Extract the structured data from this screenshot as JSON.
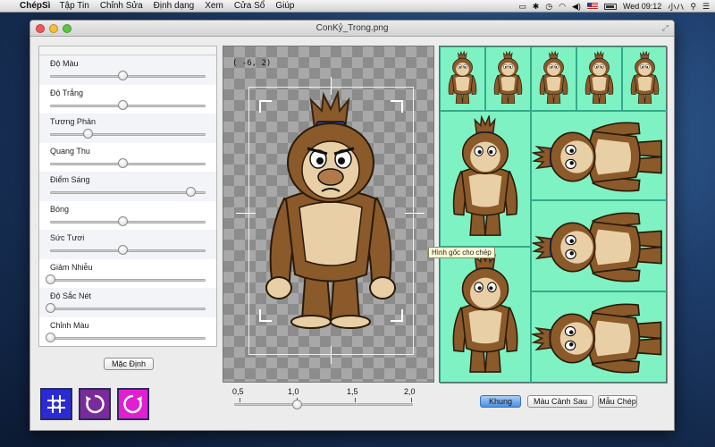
{
  "menubar": {
    "app_name": "ChépSì",
    "items": [
      "Tập Tin",
      "Chỉnh Sửa",
      "Định dạng",
      "Xem",
      "Cửa Sổ",
      "Giúp"
    ],
    "clock": "Wed 09:12",
    "user": "小ハ"
  },
  "window": {
    "title": "ConKỷ_Trong.png"
  },
  "adjustments": [
    {
      "label": "Độ Màu",
      "value": 0.5
    },
    {
      "label": "Độ Trắng",
      "value": 0.5
    },
    {
      "label": "Tương Phản",
      "value": 0.26
    },
    {
      "label": "Quang Thu",
      "value": 0.5
    },
    {
      "label": "Điểm Sáng",
      "value": 0.97
    },
    {
      "label": "Bóng",
      "value": 0.5
    },
    {
      "label": "Sức Tươi",
      "value": 0.5
    },
    {
      "label": "Giảm Nhiễu",
      "value": 0.0
    },
    {
      "label": "Độ Sắc Nét",
      "value": 0.0
    },
    {
      "label": "Chỉnh Màu",
      "value": 0.0
    }
  ],
  "buttons": {
    "default": "Mặc Định",
    "frame": "Khung",
    "background_color": "Màu Cảnh Sau",
    "copy_pattern": "Mẫu Chép"
  },
  "tools": [
    {
      "icon": "grid-crop-icon",
      "color": "#2b2bd6"
    },
    {
      "icon": "rotate-icon",
      "color": "#7a2a9a"
    },
    {
      "icon": "rotate-reset-icon",
      "color": "#e020d0"
    }
  ],
  "canvas": {
    "coordinate": "( -6,  2)"
  },
  "tooltip": "Hình gốc cho chép",
  "zoom": {
    "ticks": [
      "0,5",
      "1,0",
      "1,5",
      "2,0"
    ],
    "value": 1.0,
    "min": 0.5,
    "max": 2.0
  },
  "colors": {
    "grid_background": "#7ff2c4",
    "accent_blue": "#4a90e2"
  }
}
